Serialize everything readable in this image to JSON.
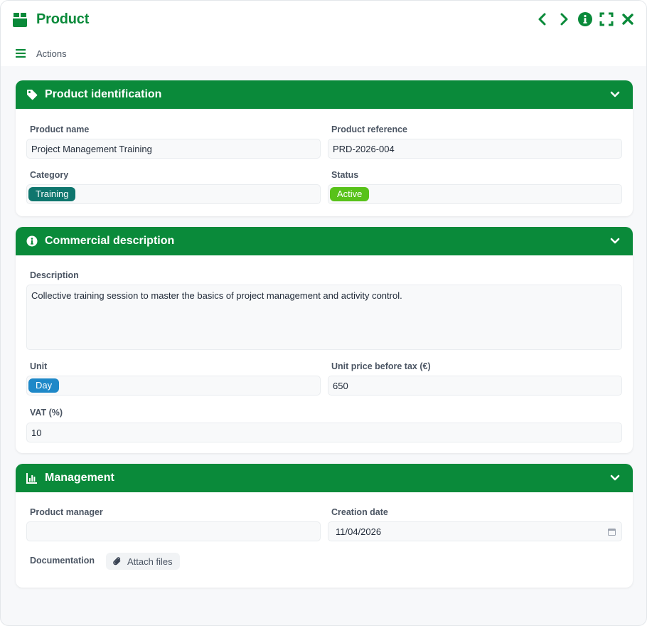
{
  "window": {
    "title": "Product",
    "actions_label": "Actions",
    "title_icons": [
      "chevron-left-icon",
      "chevron-right-icon",
      "info-icon",
      "fullscreen-icon",
      "close-icon"
    ]
  },
  "colors": {
    "brand_green": "#0a8a3a",
    "badge_training": "#0f766e",
    "badge_active": "#58c21a",
    "badge_day": "#1e88c8"
  },
  "identification": {
    "title": "Product identification",
    "product_name_label": "Product name",
    "product_name_value": "Project Management Training",
    "product_reference_label": "Product reference",
    "product_reference_value": "PRD-2026-004",
    "category_label": "Category",
    "category_value": "Training",
    "status_label": "Status",
    "status_value": "Active"
  },
  "commercial": {
    "title": "Commercial description",
    "description_label": "Description",
    "description_value": "Collective training session to master the basics of project management and activity control.",
    "unit_label": "Unit",
    "unit_value": "Day",
    "unit_price_label": "Unit price before tax (€)",
    "unit_price_value": "650",
    "vat_label": "VAT (%)",
    "vat_value": "10"
  },
  "management": {
    "title": "Management",
    "product_manager_label": "Product manager",
    "product_manager_value": "",
    "creation_date_label": "Creation date",
    "creation_date_value": "11/04/2026",
    "documentation_label": "Documentation",
    "attach_files_label": "Attach files"
  }
}
